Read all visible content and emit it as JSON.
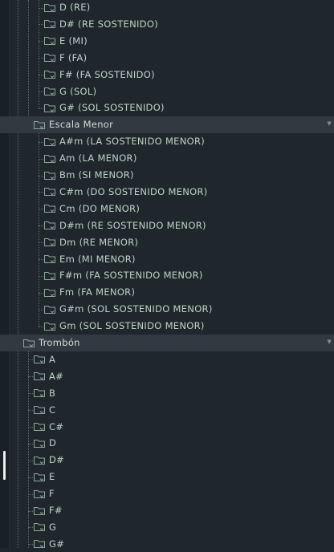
{
  "tree": {
    "nodes": [
      {
        "label": "D (RE)",
        "depth": 3
      },
      {
        "label": "D# (RE SOSTENIDO)",
        "depth": 3
      },
      {
        "label": "E (MI)",
        "depth": 3
      },
      {
        "label": "F (FA)",
        "depth": 3
      },
      {
        "label": "F# (FA SOSTENIDO)",
        "depth": 3
      },
      {
        "label": "G (SOL)",
        "depth": 3
      },
      {
        "label": "G# (SOL SOSTENIDO)",
        "depth": 3
      },
      {
        "label": "Escala Menor",
        "depth": 2,
        "header": true,
        "expanded": true
      },
      {
        "label": "A#m (LA SOSTENIDO MENOR)",
        "depth": 3
      },
      {
        "label": "Am (LA MENOR)",
        "depth": 3
      },
      {
        "label": "Bm (SI MENOR)",
        "depth": 3
      },
      {
        "label": "C#m (DO SOSTENIDO MENOR)",
        "depth": 3
      },
      {
        "label": "Cm (DO MENOR)",
        "depth": 3
      },
      {
        "label": "D#m (RE SOSTENIDO MENOR)",
        "depth": 3
      },
      {
        "label": "Dm (RE MENOR)",
        "depth": 3
      },
      {
        "label": "Em (MI MENOR)",
        "depth": 3
      },
      {
        "label": "F#m (FA SOSTENIDO MENOR)",
        "depth": 3
      },
      {
        "label": "Fm (FA MENOR)",
        "depth": 3
      },
      {
        "label": "G#m (SOL SOSTENIDO MENOR)",
        "depth": 3
      },
      {
        "label": "Gm (SOL SOSTENIDO MENOR)",
        "depth": 3
      },
      {
        "label": "Trombón",
        "depth": 1,
        "header": true,
        "expanded": true
      },
      {
        "label": "A",
        "depth": 2
      },
      {
        "label": "A#",
        "depth": 2
      },
      {
        "label": "B",
        "depth": 2
      },
      {
        "label": "C",
        "depth": 2
      },
      {
        "label": "C#",
        "depth": 2
      },
      {
        "label": "D",
        "depth": 2
      },
      {
        "label": "D#",
        "depth": 2
      },
      {
        "label": "E",
        "depth": 2
      },
      {
        "label": "F",
        "depth": 2
      },
      {
        "label": "F#",
        "depth": 2
      },
      {
        "label": "G",
        "depth": 2
      },
      {
        "label": "G#",
        "depth": 2
      }
    ]
  },
  "icons": {
    "folder": "folder-icon",
    "expanded": "chevron-down-icon"
  },
  "colors": {
    "background": "#1f272d",
    "header": "#303a40",
    "text": "#bcd3c4",
    "scroll_thumb": "#e9efe9"
  }
}
